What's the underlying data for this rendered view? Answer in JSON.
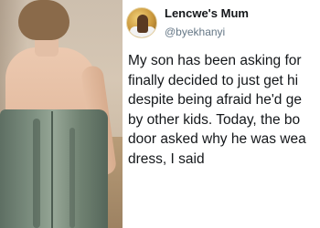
{
  "tweet": {
    "display_name": "Lencwe's Mum",
    "handle": "@byekhanyi",
    "lines": [
      "My son has been asking for",
      "finally decided to just get hi",
      "despite being afraid he'd ge",
      "by other kids. Today, the bo",
      "door asked why he was wea",
      "dress, I said"
    ]
  },
  "photo": {
    "subject": "child-in-dress-photo"
  },
  "colors": {
    "dress": "#7d8f80",
    "text": "#14171a",
    "handle": "#657786"
  }
}
